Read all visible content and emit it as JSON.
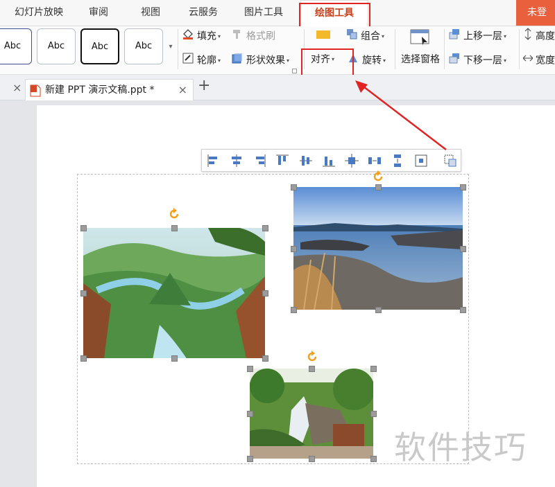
{
  "tabs": [
    {
      "label": "幻灯片放映",
      "active": false
    },
    {
      "label": "审阅",
      "active": false
    },
    {
      "label": "视图",
      "active": false
    },
    {
      "label": "云服务",
      "active": false
    },
    {
      "label": "图片工具",
      "active": false
    },
    {
      "label": "绘图工具",
      "active": true
    }
  ],
  "login_label": "未登",
  "ribbon": {
    "shape_styles": [
      "Abc",
      "Abc",
      "Abc",
      "Abc"
    ],
    "fill_label": "填充",
    "format_painter_label": "格式刷",
    "outline_label": "轮廓",
    "shape_effects_label": "形状效果",
    "group_label": "组合",
    "align_label": "对齐",
    "rotate_label": "旋转",
    "selection_pane_label": "选择窗格",
    "bring_forward_label": "上移一层",
    "send_backward_label": "下移一层",
    "height_label": "高度",
    "width_label": "宽度"
  },
  "document": {
    "tab_title": "新建 PPT 演示文稿.ppt *"
  },
  "align_toolbar": {
    "buttons": [
      "align-left",
      "align-center",
      "align-right",
      "align-top",
      "align-middle",
      "align-bottom",
      "distribute-center",
      "distribute-horizontal",
      "distribute-vertical",
      "align-to-slide",
      "select-objects"
    ]
  },
  "pictures": [
    {
      "name": "fantasy-valley-landscape"
    },
    {
      "name": "seaside-rocks-landscape"
    },
    {
      "name": "waterfall-forest-landscape"
    }
  ],
  "watermark": "软件技巧",
  "colors": {
    "accent": "#c8411b",
    "highlight": "#e02424",
    "login_bg": "#e8603c"
  }
}
